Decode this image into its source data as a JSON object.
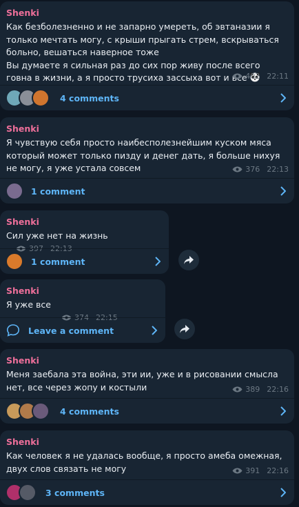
{
  "channel": {
    "author": "Shenki"
  },
  "colors": {
    "background": "#0e1621",
    "bubble": "#182533",
    "author": "#ee6f9a",
    "link": "#5eb5f7",
    "meta": "#6c7883"
  },
  "messages": [
    {
      "text": "Как безболезненно и не запарно умереть, об эвтаназии я только мечтать могу, с крыши прыгать стрем, вскрываться больно, вешаться наверное тоже\nВы думаете я сильная раз до сих пор живу после всего говна в жизни, а я просто трусиха зассыха вот и все",
      "views": "402",
      "time": "22:11",
      "comments": "4 comments",
      "avatar_colors": [
        "#6fa8b8",
        "#8a8f98",
        "#d0752e"
      ],
      "emoji_icon": "panda-face-icon"
    },
    {
      "text": "Я чувствую себя просто наибесполезнейшим куском мяса который может только пизду и денег дать, я больше нихуя не могу, я уже устала совсем",
      "views": "376",
      "time": "22:13",
      "comments": "1 comment",
      "avatar_colors": [
        "#7a6b8f"
      ]
    },
    {
      "text": "Сил уже нет на жизнь",
      "views": "397",
      "time": "22:13",
      "comments": "1 comment",
      "avatar_colors": [
        "#d97a2b"
      ]
    },
    {
      "text": "Я уже все",
      "views": "374",
      "time": "22:15",
      "comments": "Leave a comment"
    },
    {
      "text": "Меня заебала эта война, эти ии, уже и в рисовании смысла нет, все через жопу и костыли",
      "views": "389",
      "time": "22:16",
      "comments": "4 comments",
      "avatar_colors": [
        "#c89a5a",
        "#b07a4a",
        "#6a5a7a"
      ]
    },
    {
      "text": "Как человек я не удалась вообще, я просто амеба омежная, двух слов связать не могу",
      "views": "391",
      "time": "22:16",
      "comments": "3 comments",
      "avatar_colors": [
        "#b0306a",
        "#555a66"
      ]
    }
  ]
}
